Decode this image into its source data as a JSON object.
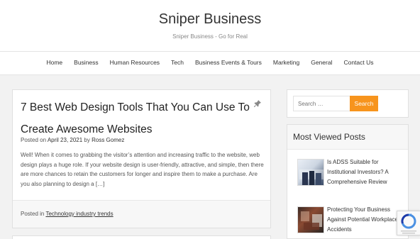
{
  "site": {
    "title": "Sniper Business",
    "tagline": "Sniper Business - Go for Real"
  },
  "nav": {
    "items": [
      "Home",
      "Business",
      "Human Resources",
      "Tech",
      "Business Events & Tours",
      "Marketing",
      "General",
      "Contact Us"
    ]
  },
  "post": {
    "title": "7 Best Web Design Tools That You Can Use To Create Awesome Websites",
    "posted_on": "Posted on",
    "date": "April 23, 2021",
    "by": "by",
    "author": "Ross Gomez",
    "excerpt": "Well! When it comes to grabbing the visitor’s attention and increasing traffic to the website, web design plays a huge role. If your website design is user-friendly, attractive, and simple, then there are more chances to retain the customers for longer and inspire them to make a purchase. Are you also planning to design a […]",
    "posted_in": "Posted in",
    "category": "Technology industry trends"
  },
  "search": {
    "placeholder": "Search …",
    "button": "Search"
  },
  "widget": {
    "title": "Most Viewed Posts",
    "items": [
      {
        "title": "Is ADSS Suitable for Institutional Investors? A Comprehensive Review"
      },
      {
        "title": "Protecting Your Business Against Potential Workplace Accidents"
      }
    ]
  },
  "icons": {
    "pin": "pin-icon",
    "recaptcha": "recaptcha-icon"
  },
  "colors": {
    "accent": "#f7941d",
    "background": "#f2f2f2"
  }
}
